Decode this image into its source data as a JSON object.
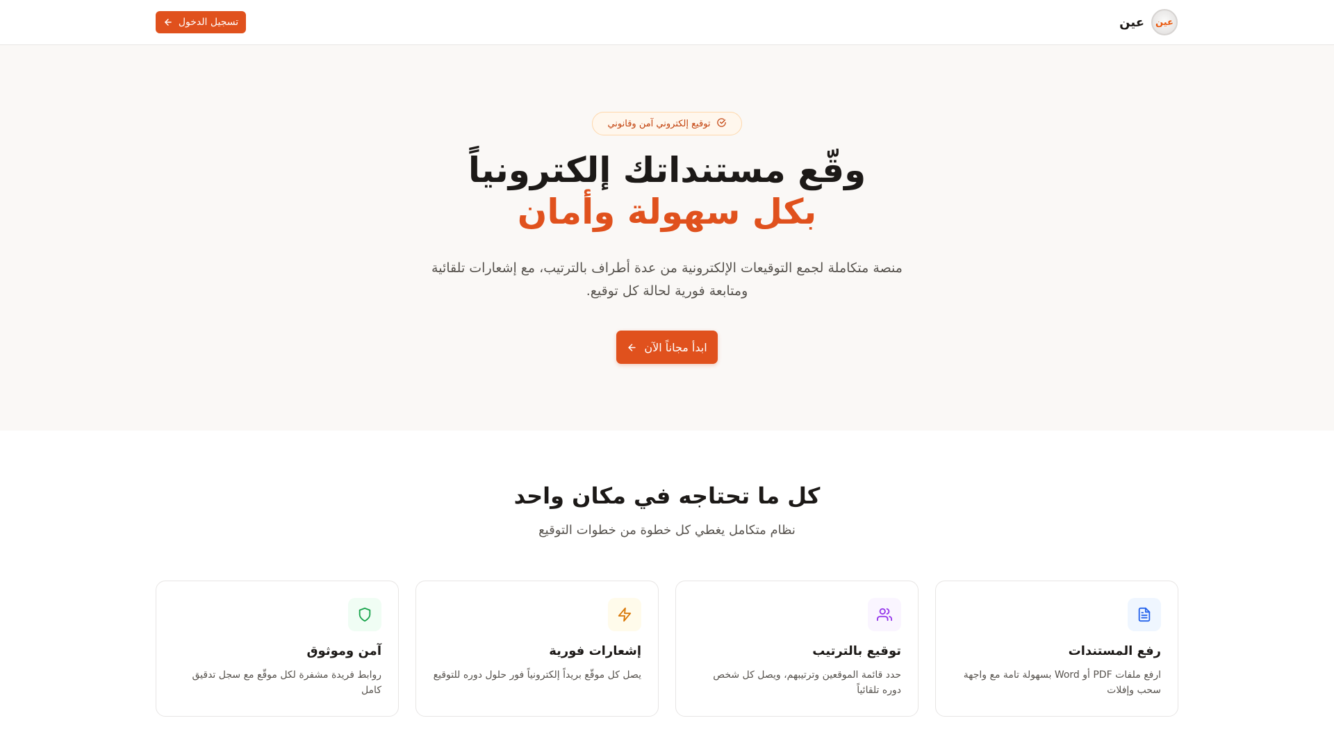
{
  "header": {
    "brand_name": "عين",
    "brand_logo_text": "عين",
    "login_label": "تسجيل الدخول"
  },
  "hero": {
    "badge": "توقيع إلكتروني آمن وقانوني",
    "title_line1": "وقّع مستنداتك إلكترونياً",
    "title_line2": "بكل سهولة وأمان",
    "description": "منصة متكاملة لجمع التوقيعات الإلكترونية من عدة أطراف بالترتيب، مع إشعارات تلقائية ومتابعة فورية لحالة كل توقيع.",
    "cta_label": "ابدأ مجاناً الآن"
  },
  "features": {
    "title": "كل ما تحتاجه في مكان واحد",
    "subtitle": "نظام متكامل يغطي كل خطوة من خطوات التوقيع",
    "cards": [
      {
        "title": "رفع المستندات",
        "description": "ارفع ملفات PDF أو Word بسهولة تامة مع واجهة سحب وإفلات",
        "icon": "file-text-icon",
        "icon_color": "#2563eb",
        "icon_bg": "#eff6ff"
      },
      {
        "title": "توقيع بالترتيب",
        "description": "حدد قائمة الموقعين وترتيبهم، ويصل كل شخص دوره تلقائياً",
        "icon": "users-icon",
        "icon_color": "#9333ea",
        "icon_bg": "#faf5ff"
      },
      {
        "title": "إشعارات فورية",
        "description": "يصل كل موقّع بريداً إلكترونياً فور حلول دوره للتوقيع",
        "icon": "lightning-icon",
        "icon_color": "#d97706",
        "icon_bg": "#fffbeb"
      },
      {
        "title": "آمن وموثوق",
        "description": "روابط فريدة مشفرة لكل موقّع مع سجل تدقيق كامل",
        "icon": "shield-icon",
        "icon_color": "#16a34a",
        "icon_bg": "#f0fdf4"
      }
    ]
  },
  "colors": {
    "accent": "#e0511d",
    "hero_background": "#faf8f6"
  }
}
